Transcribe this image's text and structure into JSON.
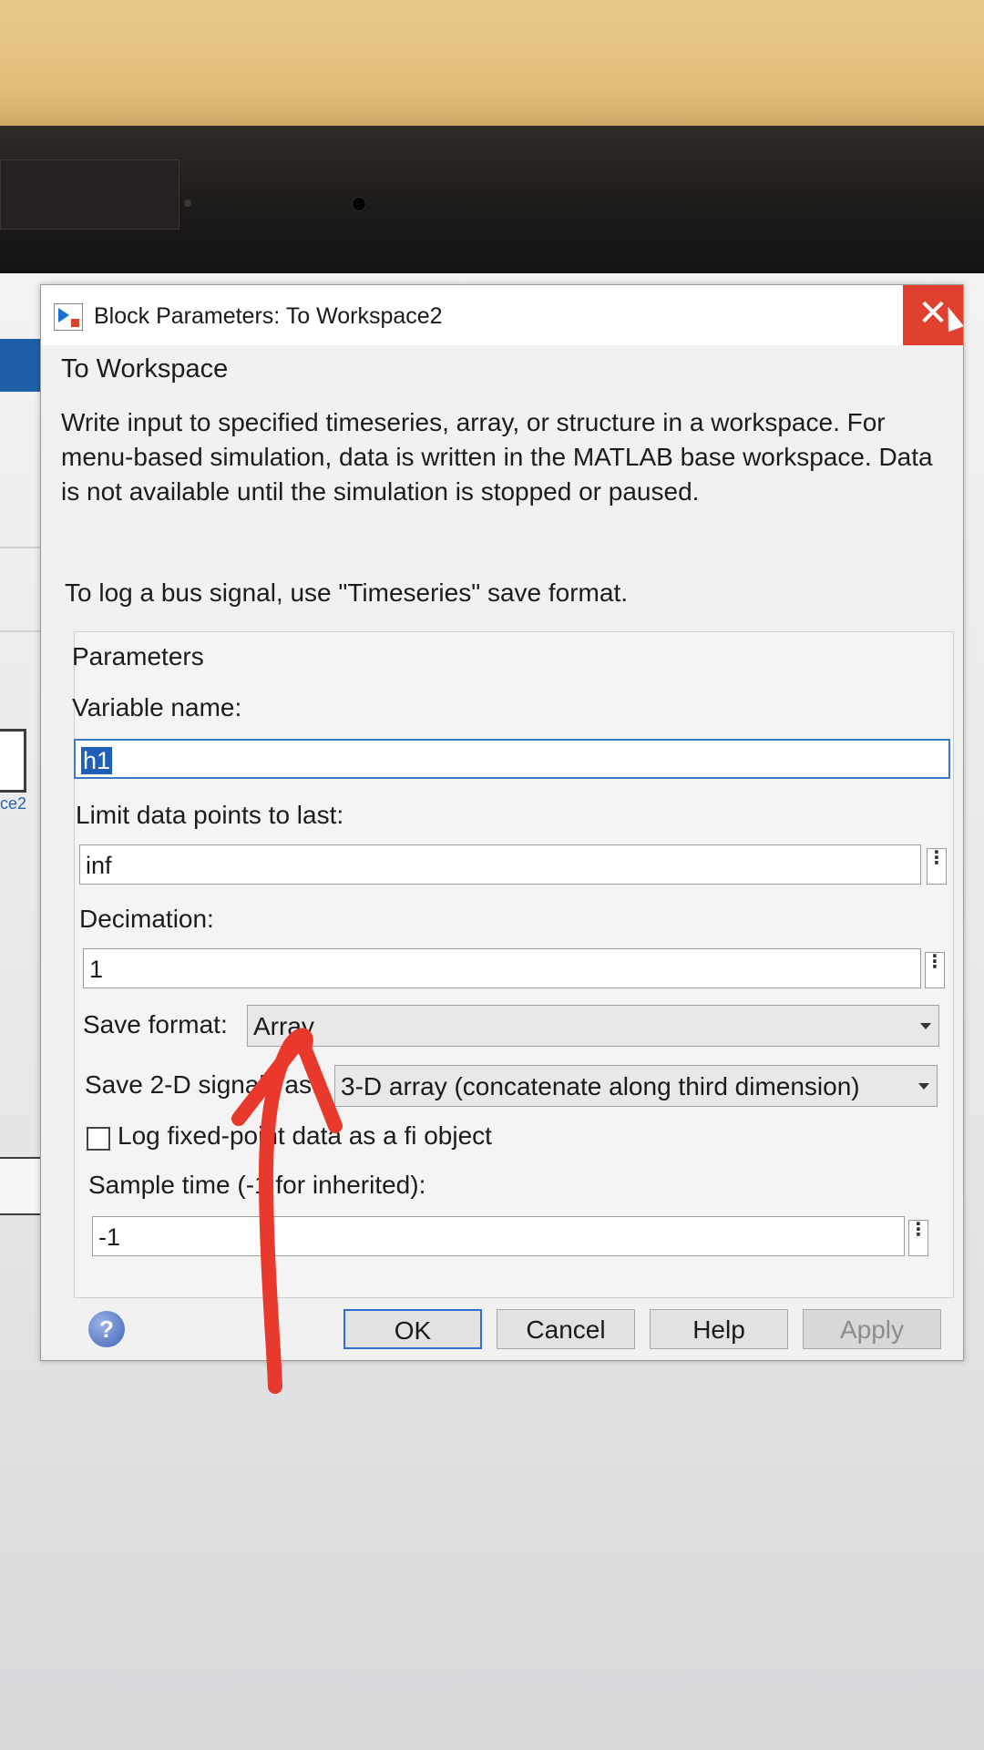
{
  "dialog": {
    "title": "Block Parameters: To Workspace2",
    "close_glyph": "✕",
    "block_name": "To Workspace",
    "description": "Write input to specified timeseries, array, or structure in a workspace. For menu-based simulation, data is written in the MATLAB base workspace. Data is not available until the simulation is stopped or paused.",
    "bus_note": "To log a bus signal, use \"Timeseries\" save format.",
    "parameters_label": "Parameters"
  },
  "fields": {
    "variable_name_label": "Variable name:",
    "variable_name_value": "h1",
    "limit_label": "Limit data points to last:",
    "limit_value": "inf",
    "decimation_label": "Decimation:",
    "decimation_value": "1",
    "save_format_label": "Save format:",
    "save_format_value": "Array",
    "save2d_label": "Save 2-D signals as:",
    "save2d_value": "3-D array (concatenate along third dimension)",
    "log_fixed_label": "Log fixed-point data as a fi object",
    "log_fixed_checked": false,
    "sample_time_label": "Sample time (-1 for inherited):",
    "sample_time_value": "-1"
  },
  "buttons": {
    "help_icon": "?",
    "ok": "OK",
    "cancel": "Cancel",
    "help": "Help",
    "apply": "Apply"
  },
  "background": {
    "block_label": "ce2"
  },
  "colors": {
    "close_red": "#e0402e",
    "focus_blue": "#3a78c9",
    "annotation_red": "#e8392c"
  }
}
